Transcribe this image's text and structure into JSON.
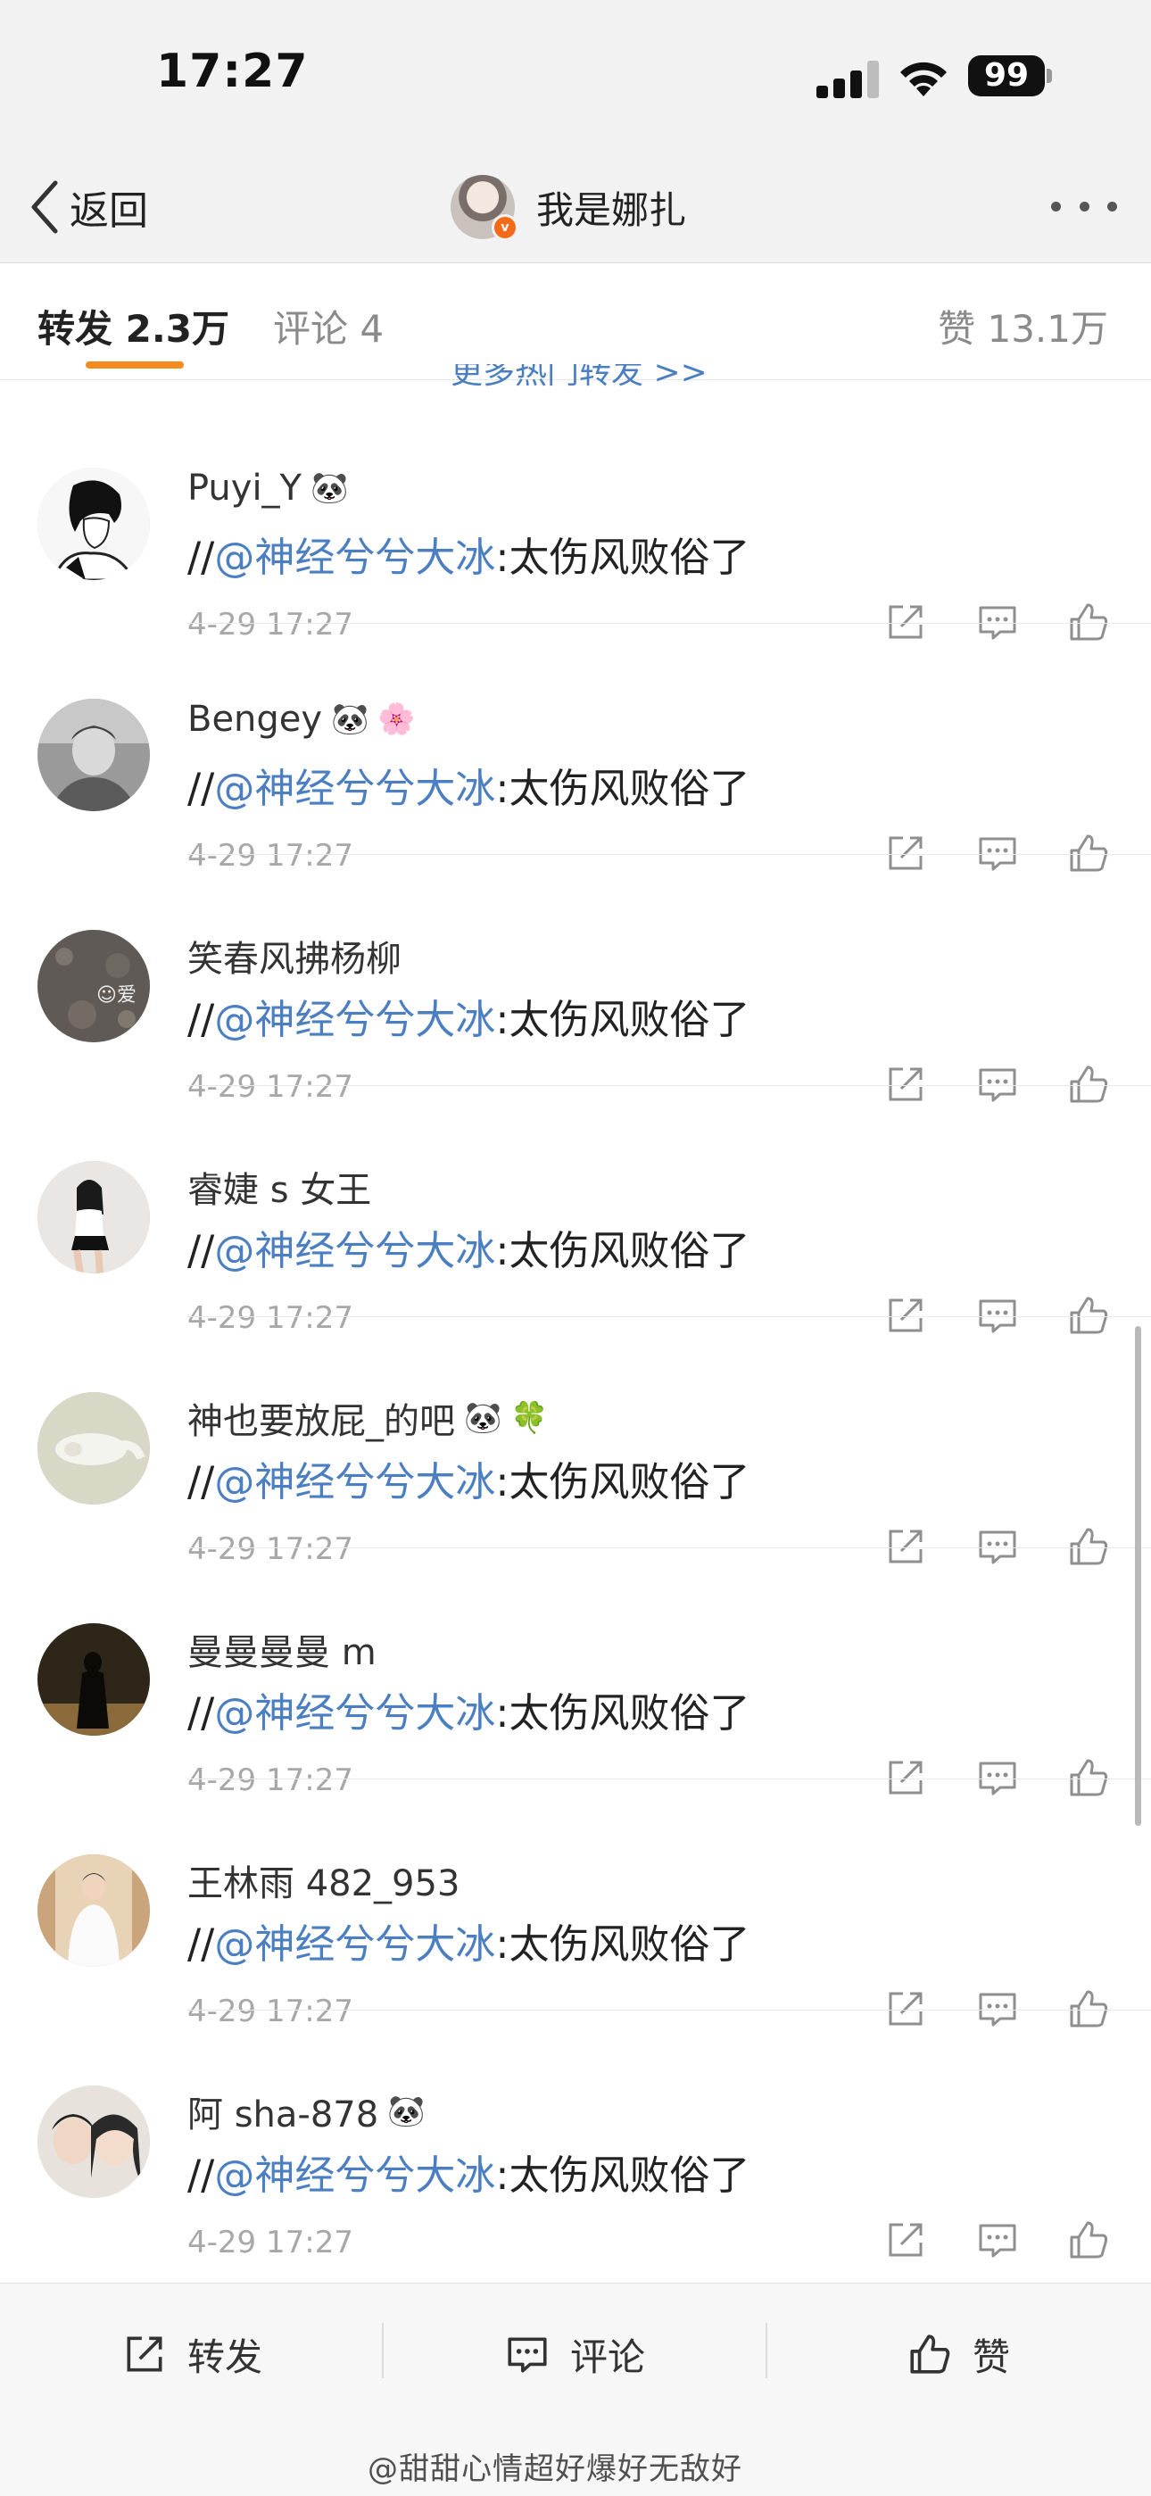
{
  "status_bar": {
    "time": "17:27",
    "battery": "99"
  },
  "nav": {
    "back_label": "返回",
    "title": "我是娜扎"
  },
  "tabs": {
    "repost": "转发 2.3万",
    "comment": "评论 4",
    "like": "赞 13.1万",
    "more_hot": "更多热门转发 >>"
  },
  "reposts": [
    {
      "user": "Puyi_Y",
      "badges": [
        "🐼"
      ],
      "prefix": "//",
      "mention": "@神经兮兮大冰",
      "text": ":太伤风败俗了",
      "time": "4-29 17:27"
    },
    {
      "user": "Bengey",
      "badges": [
        "🐼",
        "🌸"
      ],
      "prefix": "//",
      "mention": "@神经兮兮大冰",
      "text": ":太伤风败俗了",
      "time": "4-29 17:27"
    },
    {
      "user": "笑春风拂杨柳",
      "badges": [],
      "prefix": "//",
      "mention": "@神经兮兮大冰",
      "text": ":太伤风败俗了",
      "time": "4-29 17:27"
    },
    {
      "user": "睿婕 s 女王",
      "badges": [],
      "prefix": "//",
      "mention": "@神经兮兮大冰",
      "text": ":太伤风败俗了",
      "time": "4-29 17:27"
    },
    {
      "user": "神也要放屁_的吧",
      "badges": [
        "🐼",
        "🍀"
      ],
      "prefix": "//",
      "mention": "@神经兮兮大冰",
      "text": ":太伤风败俗了",
      "time": "4-29 17:27"
    },
    {
      "user": "曼曼曼曼 m",
      "badges": [],
      "prefix": "//",
      "mention": "@神经兮兮大冰",
      "text": ":太伤风败俗了",
      "time": "4-29 17:27"
    },
    {
      "user": "王林雨 482_953",
      "badges": [],
      "prefix": "//",
      "mention": "@神经兮兮大冰",
      "text": ":太伤风败俗了",
      "time": "4-29 17:27"
    },
    {
      "user": "阿 sha-878",
      "badges": [
        "🐼"
      ],
      "prefix": "//",
      "mention": "@神经兮兮大冰",
      "text": ":太伤风败俗了",
      "time": "4-29 17:27"
    }
  ],
  "toolbar": {
    "repost": "转发",
    "comment": "评论",
    "like": "赞"
  },
  "watermark": "@甜甜心情超好爆好无敌好",
  "colors": {
    "link": "#4b7fc2",
    "accent": "#f58a1f",
    "muted": "#a8a8a8"
  }
}
